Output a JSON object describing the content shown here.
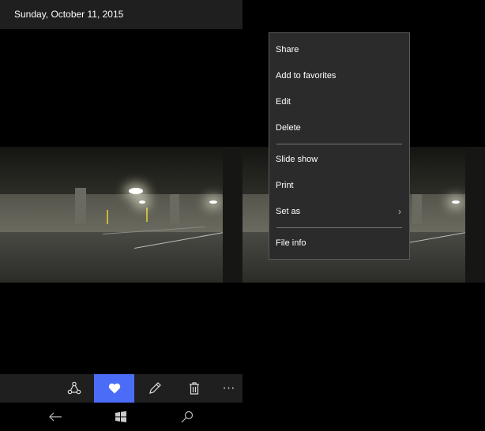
{
  "header": {
    "date": "Sunday, October 11, 2015"
  },
  "toolbar": {
    "items": [
      {
        "name": "share",
        "icon": "share-icon"
      },
      {
        "name": "favorite",
        "icon": "heart-icon",
        "active": true
      },
      {
        "name": "edit",
        "icon": "pencil-icon"
      },
      {
        "name": "delete",
        "icon": "trash-icon"
      },
      {
        "name": "more",
        "icon": "more-icon",
        "label": "···"
      }
    ],
    "accent": "#4a6cf7"
  },
  "navbar": {
    "items": [
      "back-icon",
      "windows-icon",
      "search-icon"
    ]
  },
  "menu": {
    "items": [
      {
        "label": "Share"
      },
      {
        "label": "Add to favorites"
      },
      {
        "label": "Edit"
      },
      {
        "label": "Delete"
      },
      {
        "label": "Slide show"
      },
      {
        "label": "Print"
      },
      {
        "label": "Set as",
        "chevron": "›"
      },
      {
        "label": "File info"
      }
    ]
  }
}
